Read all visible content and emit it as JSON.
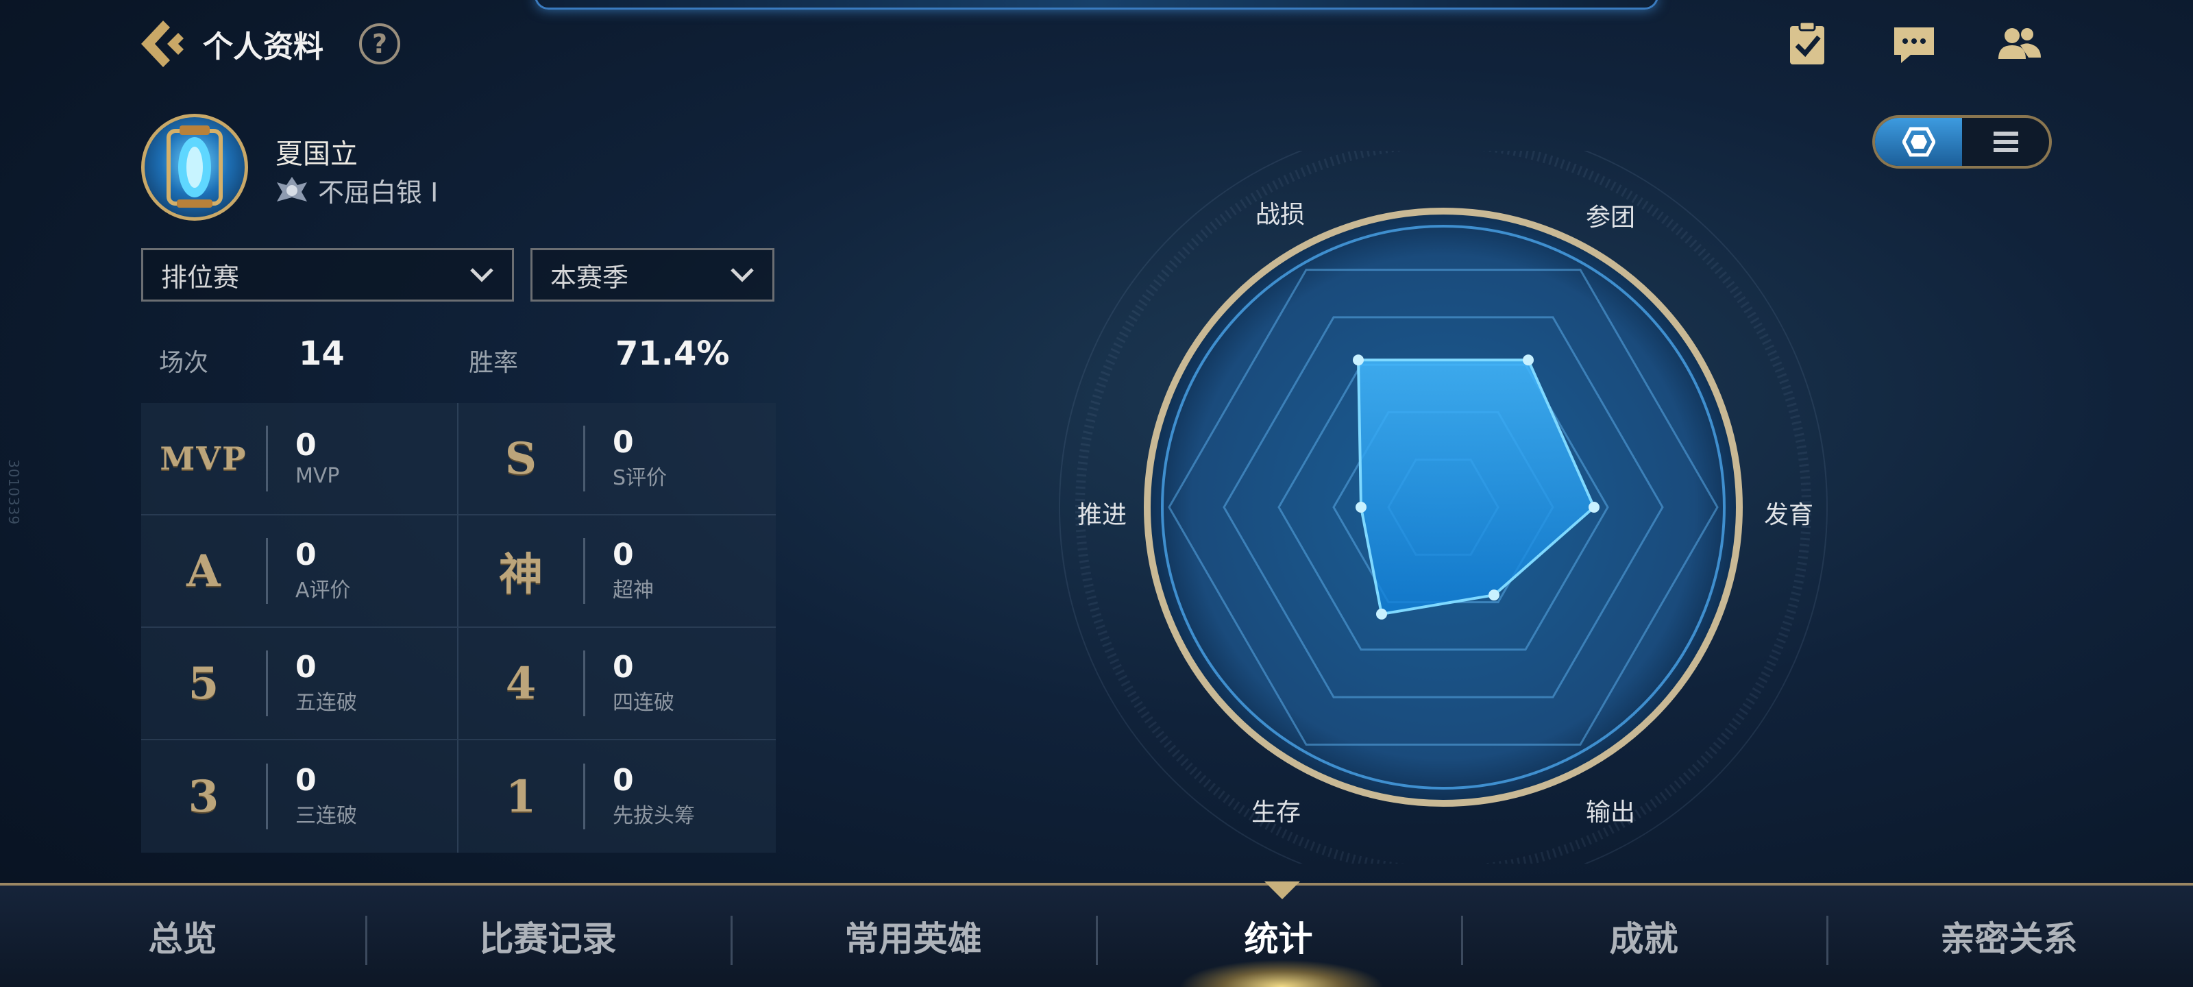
{
  "header": {
    "title": "个人资料",
    "help_symbol": "?",
    "icons": [
      "back-icon",
      "task-checklist-icon",
      "chat-icon",
      "friends-icon"
    ]
  },
  "vertical_code": "3010339",
  "profile": {
    "name": "夏国立",
    "rank": "不屈白银 Ⅰ"
  },
  "filters": {
    "mode": "排位赛",
    "season": "本赛季"
  },
  "summary": {
    "matches_label": "场次",
    "matches_value": "14",
    "winrate_label": "胜率",
    "winrate_value": "71.4%"
  },
  "stats": [
    {
      "glyph": "MVP",
      "value": "0",
      "label": "MVP"
    },
    {
      "glyph": "S",
      "value": "0",
      "label": "S评价"
    },
    {
      "glyph": "A",
      "value": "0",
      "label": "A评价"
    },
    {
      "glyph": "神",
      "value": "0",
      "label": "超神"
    },
    {
      "glyph": "5",
      "value": "0",
      "label": "五连破"
    },
    {
      "glyph": "4",
      "value": "0",
      "label": "四连破"
    },
    {
      "glyph": "3",
      "value": "0",
      "label": "三连破"
    },
    {
      "glyph": "1",
      "value": "0",
      "label": "先拔头筹"
    }
  ],
  "radar": {
    "axes": [
      "战损",
      "参团",
      "发育",
      "输出",
      "生存",
      "推进"
    ],
    "values": [
      0.62,
      0.62,
      0.55,
      0.37,
      0.45,
      0.3
    ],
    "view_modes": [
      "radar-view-icon",
      "list-view-icon"
    ],
    "active_view": 0
  },
  "nav": {
    "tabs": [
      "总览",
      "比赛记录",
      "常用英雄",
      "统计",
      "成就",
      "亲密关系"
    ],
    "active": 3
  },
  "colors": {
    "accent_gold": "#c9a867",
    "radar_blue": "#3fb8ff",
    "background": "#0e1e33"
  }
}
